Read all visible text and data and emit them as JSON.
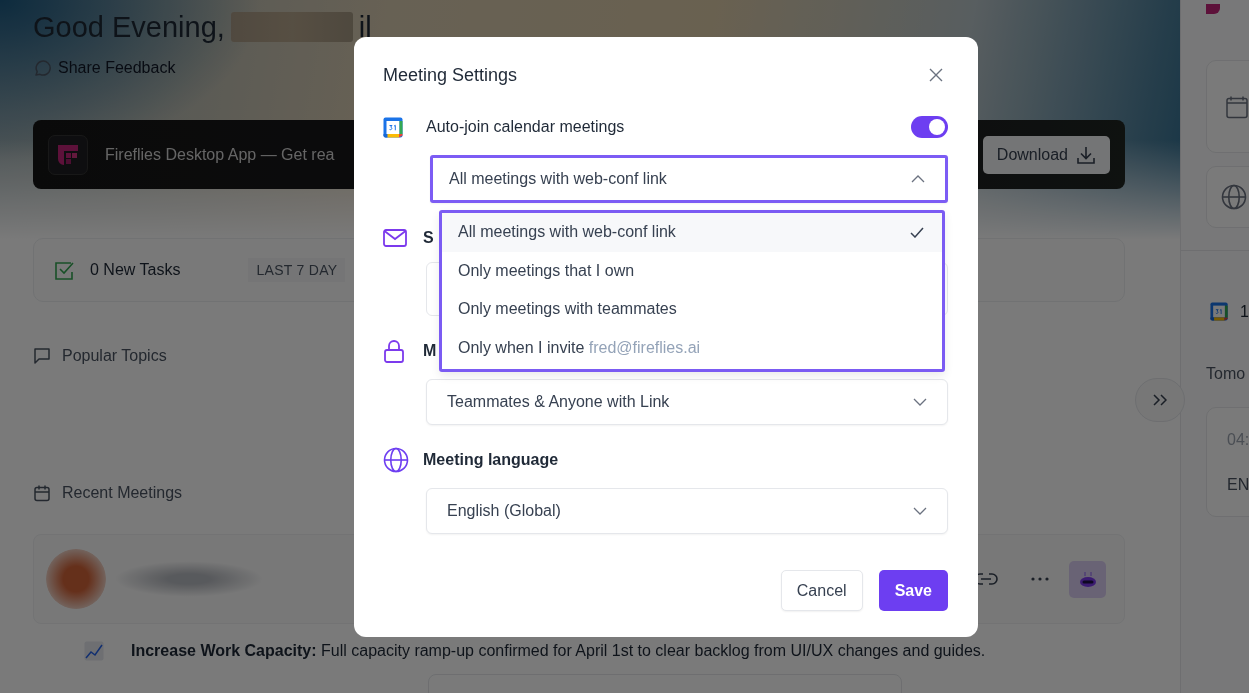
{
  "page": {
    "greeting": "Good Evening,",
    "greeting_tail": "il",
    "share_feedback": "Share Feedback",
    "banner": {
      "text": "Fireflies Desktop App — Get rea",
      "button": "Download"
    },
    "tasks": {
      "count": "0 New Tasks",
      "range": "LAST 7 DAY"
    },
    "popular_topics": "Popular Topics",
    "recent_meetings": "Recent Meetings",
    "summary": "**Increase Work Capacity:** Full capacity ramp-up confirmed for April 1st to clear backlog from UI/UX changes and guides."
  },
  "right_panel": {
    "calendar_count": "1",
    "day": "Tomo",
    "event": {
      "time": "04:",
      "language": "EN"
    }
  },
  "modal": {
    "title": "Meeting Settings",
    "settings": [
      {
        "kind": "toggle",
        "label": "Auto-join calendar meetings",
        "on": true,
        "value": "All meetings with web-conf link",
        "expanded": true,
        "options": [
          {
            "label": "All meetings with web-conf link",
            "selected": true
          },
          {
            "label": "Only meetings that I own",
            "selected": false
          },
          {
            "label": "Only meetings with teammates",
            "selected": false
          },
          {
            "label": "Only when I invite",
            "email": "fred@fireflies.ai",
            "selected": false
          }
        ]
      },
      {
        "kind": "field",
        "label": "S"
      },
      {
        "kind": "select",
        "label": "M",
        "value": "Teammates & Anyone with Link"
      },
      {
        "kind": "select",
        "label": "Meeting language",
        "value": "English (Global)"
      }
    ],
    "buttons": {
      "cancel": "Cancel",
      "save": "Save"
    }
  }
}
